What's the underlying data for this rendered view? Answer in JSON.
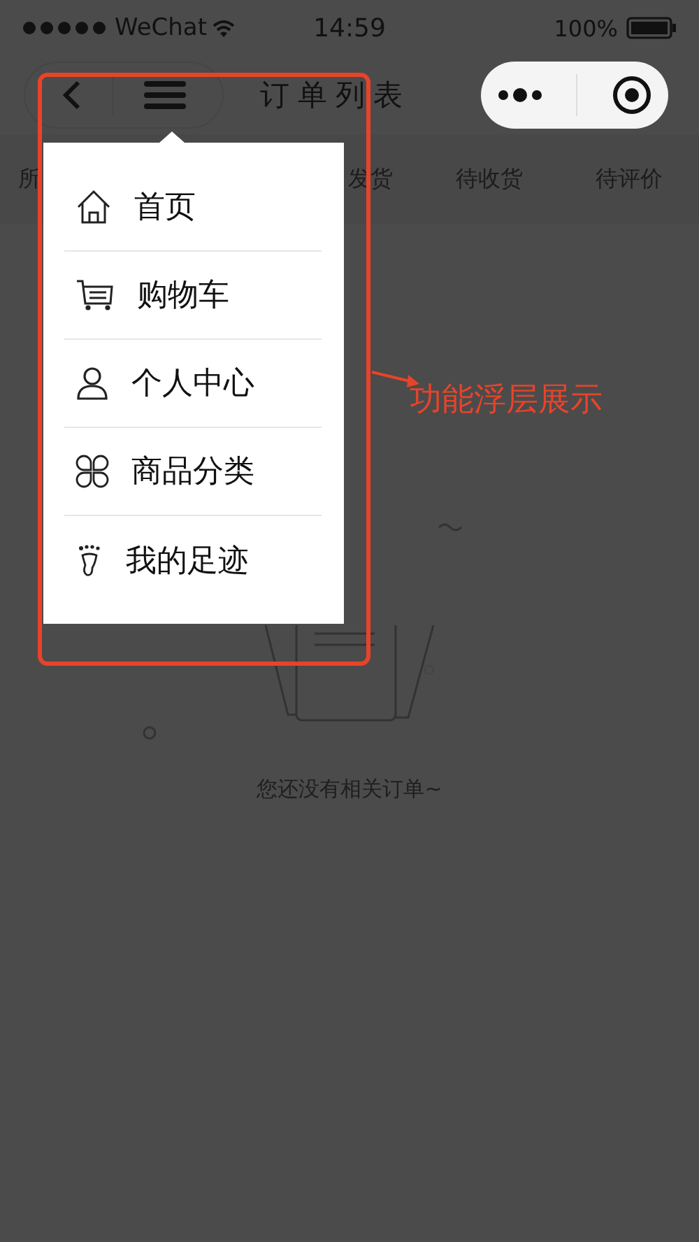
{
  "status_bar": {
    "carrier": "WeChat",
    "time": "14:59",
    "battery": "100%"
  },
  "nav": {
    "title": "订单列表"
  },
  "tabs": [
    {
      "label": "所"
    },
    {
      "label": "发货"
    },
    {
      "label": "待收货"
    },
    {
      "label": "待评价"
    }
  ],
  "menu": {
    "items": [
      {
        "label": "首页",
        "kind": "home"
      },
      {
        "label": "购物车",
        "kind": "cart"
      },
      {
        "label": "个人中心",
        "kind": "person"
      },
      {
        "label": "商品分类",
        "kind": "category"
      },
      {
        "label": "我的足迹",
        "kind": "footprint"
      }
    ]
  },
  "empty_state": {
    "message": "您还没有相关订单~"
  },
  "annotation": {
    "label": "功能浮层展示"
  }
}
